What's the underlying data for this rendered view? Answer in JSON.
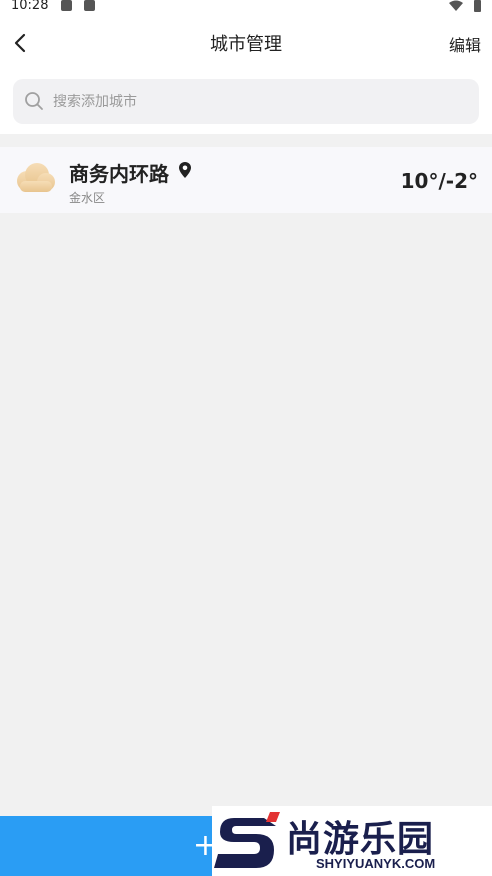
{
  "status_bar": {
    "time": "10:28"
  },
  "header": {
    "title": "城市管理",
    "edit_label": "编辑"
  },
  "search": {
    "placeholder": "搜索添加城市"
  },
  "cities": [
    {
      "name": "商务内环路",
      "district": "金水区",
      "temperature": "10°/-2°",
      "weather_icon": "cloud-icon",
      "is_current_location": true
    }
  ],
  "footer": {
    "add_label": "+"
  },
  "watermark": {
    "logo_text": "尚游乐园",
    "url": "SHYIYUANYK.COM"
  },
  "colors": {
    "accent": "#2a9df4",
    "background": "#f1f1f1",
    "card": "#f8f8fb"
  }
}
